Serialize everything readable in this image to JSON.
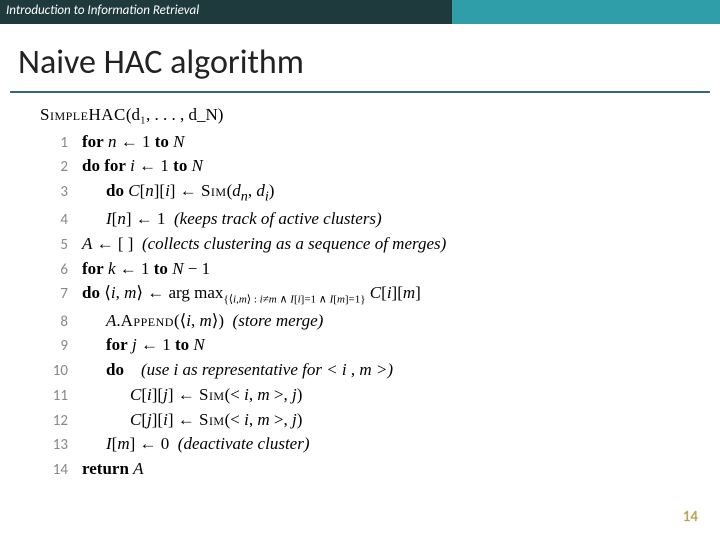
{
  "header": {
    "course": "Introduction to Information Retrieval"
  },
  "slide": {
    "title": "Naive HAC algorithm",
    "page_number": "14"
  },
  "algo": {
    "name_sc": "SimpleHAC",
    "args": "(d₁, . . . , d_N)",
    "lines": [
      {
        "n": "1",
        "indent": 1,
        "parts": [
          "<b>for</b> <i>n</i> ← 1 <b>to</b> <i>N</i>"
        ]
      },
      {
        "n": "2",
        "indent": 1,
        "parts": [
          "<b>do for</b> <i>i</i> ← 1 <b>to</b> <i>N</i>"
        ]
      },
      {
        "n": "3",
        "indent": 2,
        "parts": [
          "<b>do</b> <i>C</i>[<i>n</i>][<i>i</i>] ← <span class='sc'>Sim</span>(<i>d<sub>n</sub></i>, <i>d<sub>i</sub></i>)"
        ]
      },
      {
        "n": "4",
        "indent": 2,
        "parts": [
          "<i>I</i>[<i>n</i>] ← 1&nbsp;&nbsp;<span class='comment'>(keeps track of active clusters)</span>"
        ]
      },
      {
        "n": "5",
        "indent": 1,
        "parts": [
          "<i>A</i> ← [ ]&nbsp;&nbsp;<span class='comment'>(collects clustering as a sequence of merges)</span>"
        ]
      },
      {
        "n": "6",
        "indent": 1,
        "parts": [
          "<b>for</b> <i>k</i> ← 1 <b>to</b> <i>N</i> − 1"
        ]
      },
      {
        "n": "7",
        "indent": 1,
        "parts": [
          "<b>do</b> ⟨<i>i</i>, <i>m</i>⟩ ← arg max<span class='sub'>{⟨<i>i</i>,<i>m</i>⟩ : <i>i</i>≠<i>m</i> ∧ <i>I</i>[<i>i</i>]=1 ∧ <i>I</i>[<i>m</i>]=1}</span> <i>C</i>[<i>i</i>][<i>m</i>]"
        ]
      },
      {
        "n": "8",
        "indent": 2,
        "parts": [
          "<i>A</i>.<span class='sc'>Append</span>(⟨<i>i</i>, <i>m</i>⟩)&nbsp;&nbsp;<span class='comment'>(store merge)</span>"
        ]
      },
      {
        "n": "9",
        "indent": 2,
        "parts": [
          "<b>for</b> <i>j</i> ← 1 <b>to</b> <i>N</i>"
        ]
      },
      {
        "n": "10",
        "indent": 2,
        "parts": [
          "<b>do</b>&nbsp;&nbsp;&nbsp;&nbsp;<span class='comment'>(use i as representative for &lt; i , m &gt;)</span>"
        ]
      },
      {
        "n": "11",
        "indent": 3,
        "parts": [
          "<i>C</i>[<i>i</i>][<i>j</i>] ← <span class='sc'>Sim</span>(&lt; <i>i</i>, <i>m</i> &gt;, <i>j</i>)"
        ]
      },
      {
        "n": "12",
        "indent": 3,
        "parts": [
          "<i>C</i>[<i>j</i>][<i>i</i>] ← <span class='sc'>Sim</span>(&lt; <i>i</i>, <i>m</i> &gt;, <i>j</i>)"
        ]
      },
      {
        "n": "13",
        "indent": 2,
        "parts": [
          "<i>I</i>[<i>m</i>] ← 0&nbsp;&nbsp;<span class='comment'>(deactivate cluster)</span>"
        ]
      },
      {
        "n": "14",
        "indent": 1,
        "parts": [
          "<b>return</b> <i>A</i>"
        ]
      }
    ]
  }
}
